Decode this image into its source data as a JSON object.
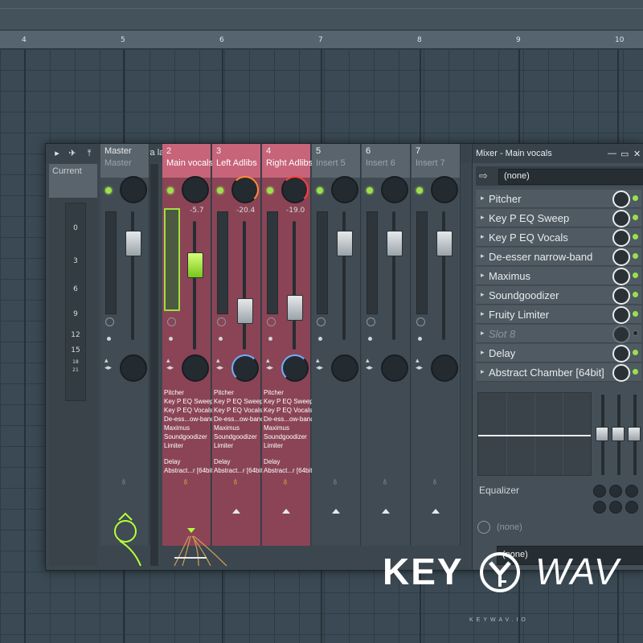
{
  "ruler": {
    "marks": [
      "4",
      "5",
      "6",
      "7",
      "8",
      "9",
      "10"
    ]
  },
  "toolbar": {
    "preset_label": "Extra large"
  },
  "current_strip": {
    "label": "Current",
    "scale": [
      "0",
      "3",
      "6",
      "9",
      "12",
      "15",
      "18",
      "21"
    ]
  },
  "strips": [
    {
      "num": "",
      "name": "Master",
      "sub": "Master",
      "value": "",
      "selected": false
    },
    {
      "num": "2",
      "name": "Main vocals",
      "value": "-5.7",
      "selected": true
    },
    {
      "num": "3",
      "name": "Left Adlibs",
      "value": "-20.4",
      "selected": true
    },
    {
      "num": "4",
      "name": "Right Adlibs",
      "value": "-19.0",
      "selected": true
    },
    {
      "num": "5",
      "name": "Insert 5",
      "value": "",
      "selected": false
    },
    {
      "num": "6",
      "name": "Insert 6",
      "value": "",
      "selected": false
    },
    {
      "num": "7",
      "name": "Insert 7",
      "value": "",
      "selected": false
    }
  ],
  "fx_list": {
    "items": [
      "Pitcher",
      "Key P EQ Sweep",
      "Key P EQ Vocals",
      "De-ess...ow-band",
      "Maximus",
      "Soundgoodizer",
      "Limiter"
    ],
    "items2": [
      "Delay",
      "Abstract...r [64bit]"
    ]
  },
  "panel": {
    "title": "Mixer - Main vocals",
    "input_value": "(none)",
    "slots": [
      {
        "label": "Pitcher",
        "empty": false
      },
      {
        "label": "Key P EQ Sweep",
        "empty": false
      },
      {
        "label": "Key P EQ Vocals",
        "empty": false
      },
      {
        "label": "De-esser narrow-band",
        "empty": false
      },
      {
        "label": "Maximus",
        "empty": false
      },
      {
        "label": "Soundgoodizer",
        "empty": false
      },
      {
        "label": "Fruity Limiter",
        "empty": false
      },
      {
        "label": "Slot 8",
        "empty": true
      },
      {
        "label": "Delay",
        "empty": false
      },
      {
        "label": "Abstract Chamber [64bit]",
        "empty": false
      }
    ],
    "eq_label": "Equalizer",
    "output_value": "(none)",
    "output2_value": "(none)"
  },
  "logo": {
    "key": "KEY",
    "wav": "WAV",
    "tagline": "KEYWAV.IO"
  },
  "colors": {
    "selected_strip": "#8a4456",
    "accent_green": "#9be04b",
    "background": "#3b4a55"
  }
}
